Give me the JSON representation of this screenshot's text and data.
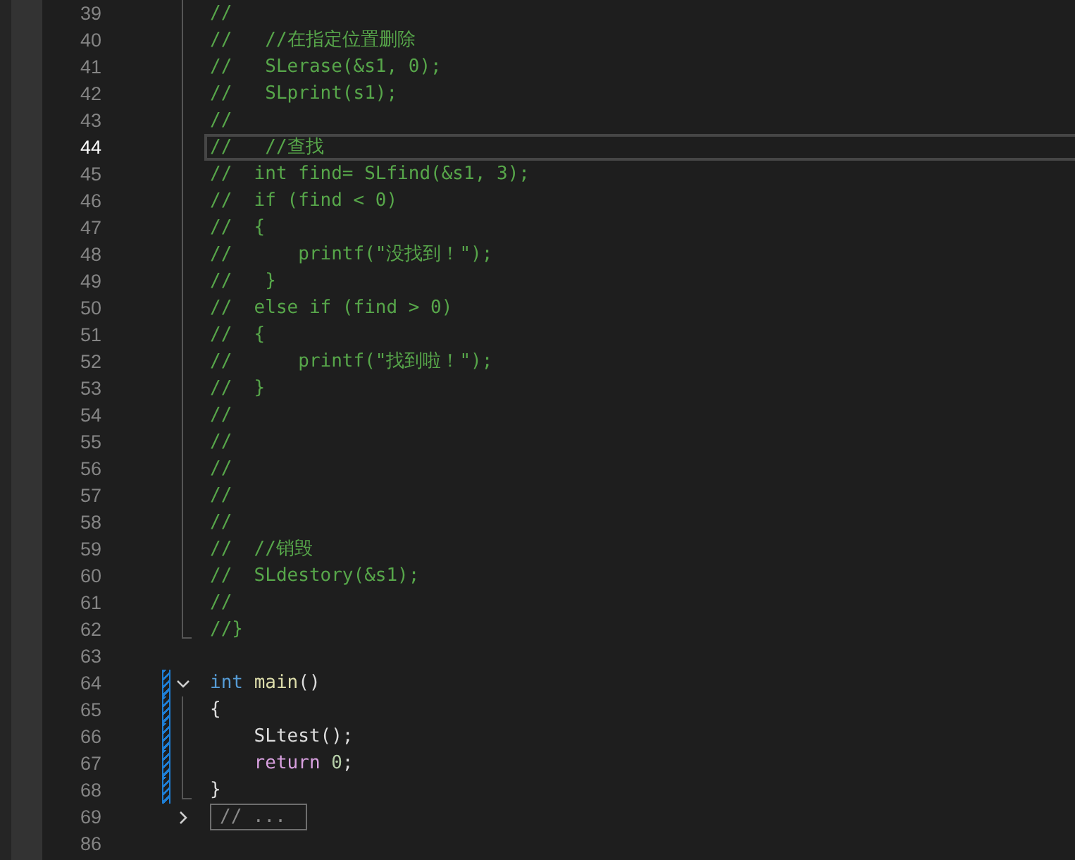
{
  "editor": {
    "blocks": [
      {
        "kind": "fold",
        "lines": [
          {
            "number": "39",
            "current": false,
            "modified": false,
            "tokens": [
              {
                "text": "//",
                "kind": "comment"
              }
            ]
          },
          {
            "number": "40",
            "current": false,
            "modified": false,
            "tokens": [
              {
                "text": "//   //在指定位置删除",
                "kind": "comment"
              }
            ]
          },
          {
            "number": "41",
            "current": false,
            "modified": false,
            "tokens": [
              {
                "text": "//   SLerase(&s1, 0);",
                "kind": "comment"
              }
            ]
          },
          {
            "number": "42",
            "current": false,
            "modified": false,
            "tokens": [
              {
                "text": "//   SLprint(s1);",
                "kind": "comment"
              }
            ]
          },
          {
            "number": "43",
            "current": false,
            "modified": false,
            "tokens": [
              {
                "text": "//",
                "kind": "comment"
              }
            ]
          },
          {
            "number": "44",
            "current": true,
            "modified": false,
            "tokens": [
              {
                "text": "//   //查找",
                "kind": "comment"
              }
            ]
          },
          {
            "number": "45",
            "current": false,
            "modified": false,
            "tokens": [
              {
                "text": "//  int find= SLfind(&s1, 3);",
                "kind": "comment"
              }
            ]
          },
          {
            "number": "46",
            "current": false,
            "modified": false,
            "tokens": [
              {
                "text": "//  if (find < 0)",
                "kind": "comment"
              }
            ]
          },
          {
            "number": "47",
            "current": false,
            "modified": false,
            "tokens": [
              {
                "text": "//  {",
                "kind": "comment"
              }
            ]
          },
          {
            "number": "48",
            "current": false,
            "modified": false,
            "tokens": [
              {
                "text": "//      printf(\"没找到！\");",
                "kind": "comment"
              }
            ]
          },
          {
            "number": "49",
            "current": false,
            "modified": false,
            "tokens": [
              {
                "text": "//   }",
                "kind": "comment"
              }
            ]
          },
          {
            "number": "50",
            "current": false,
            "modified": false,
            "tokens": [
              {
                "text": "//  else if (find > 0)",
                "kind": "comment"
              }
            ]
          },
          {
            "number": "51",
            "current": false,
            "modified": false,
            "tokens": [
              {
                "text": "//  {",
                "kind": "comment"
              }
            ]
          },
          {
            "number": "52",
            "current": false,
            "modified": false,
            "tokens": [
              {
                "text": "//      printf(\"找到啦！\");",
                "kind": "comment"
              }
            ]
          },
          {
            "number": "53",
            "current": false,
            "modified": false,
            "tokens": [
              {
                "text": "//  }",
                "kind": "comment"
              }
            ]
          },
          {
            "number": "54",
            "current": false,
            "modified": false,
            "tokens": [
              {
                "text": "//",
                "kind": "comment"
              }
            ]
          },
          {
            "number": "55",
            "current": false,
            "modified": false,
            "tokens": [
              {
                "text": "//",
                "kind": "comment"
              }
            ]
          },
          {
            "number": "56",
            "current": false,
            "modified": false,
            "tokens": [
              {
                "text": "//",
                "kind": "comment"
              }
            ]
          },
          {
            "number": "57",
            "current": false,
            "modified": false,
            "tokens": [
              {
                "text": "//",
                "kind": "comment"
              }
            ]
          },
          {
            "number": "58",
            "current": false,
            "modified": false,
            "tokens": [
              {
                "text": "//",
                "kind": "comment"
              }
            ]
          },
          {
            "number": "59",
            "current": false,
            "modified": false,
            "tokens": [
              {
                "text": "//  //销毁",
                "kind": "comment"
              }
            ]
          },
          {
            "number": "60",
            "current": false,
            "modified": false,
            "tokens": [
              {
                "text": "//  SLdestory(&s1);",
                "kind": "comment"
              }
            ]
          },
          {
            "number": "61",
            "current": false,
            "modified": false,
            "tokens": [
              {
                "text": "//",
                "kind": "comment"
              }
            ]
          },
          {
            "number": "62",
            "current": false,
            "modified": false,
            "tokens": [
              {
                "text": "//}",
                "kind": "comment"
              }
            ]
          }
        ]
      },
      {
        "kind": "plain",
        "lines": [
          {
            "number": "63",
            "current": false,
            "modified": false
          }
        ]
      },
      {
        "kind": "function",
        "expanded": true,
        "lines": [
          {
            "number": "64",
            "current": false,
            "modified": true,
            "tokens": [
              {
                "text": "int ",
                "kind": "keyword"
              },
              {
                "text": "main",
                "kind": "function"
              },
              {
                "text": "()",
                "kind": "plain"
              }
            ]
          },
          {
            "number": "65",
            "current": false,
            "modified": true,
            "tokens": [
              {
                "text": "{",
                "kind": "plain"
              }
            ]
          },
          {
            "number": "66",
            "current": false,
            "modified": true,
            "tokens": [
              {
                "text": "    SLtest();",
                "kind": "plain"
              }
            ]
          },
          {
            "number": "67",
            "current": false,
            "modified": true,
            "tokens": [
              {
                "text": "    return ",
                "kind": "control"
              },
              {
                "text": "0",
                "kind": "number"
              },
              {
                "text": ";",
                "kind": "plain"
              }
            ]
          },
          {
            "number": "68",
            "current": false,
            "modified": true,
            "tokens": [
              {
                "text": "}",
                "kind": "plain"
              }
            ]
          }
        ]
      },
      {
        "kind": "function",
        "expanded": false,
        "lines": [
          {
            "number": "69",
            "current": false,
            "modified": false,
            "tokens": [
              {
                "text": "// ...",
                "kind": "comment"
              }
            ]
          }
        ]
      },
      {
        "kind": "plain",
        "lines": [
          {
            "number": "86",
            "current": false,
            "modified": false
          }
        ]
      }
    ]
  }
}
